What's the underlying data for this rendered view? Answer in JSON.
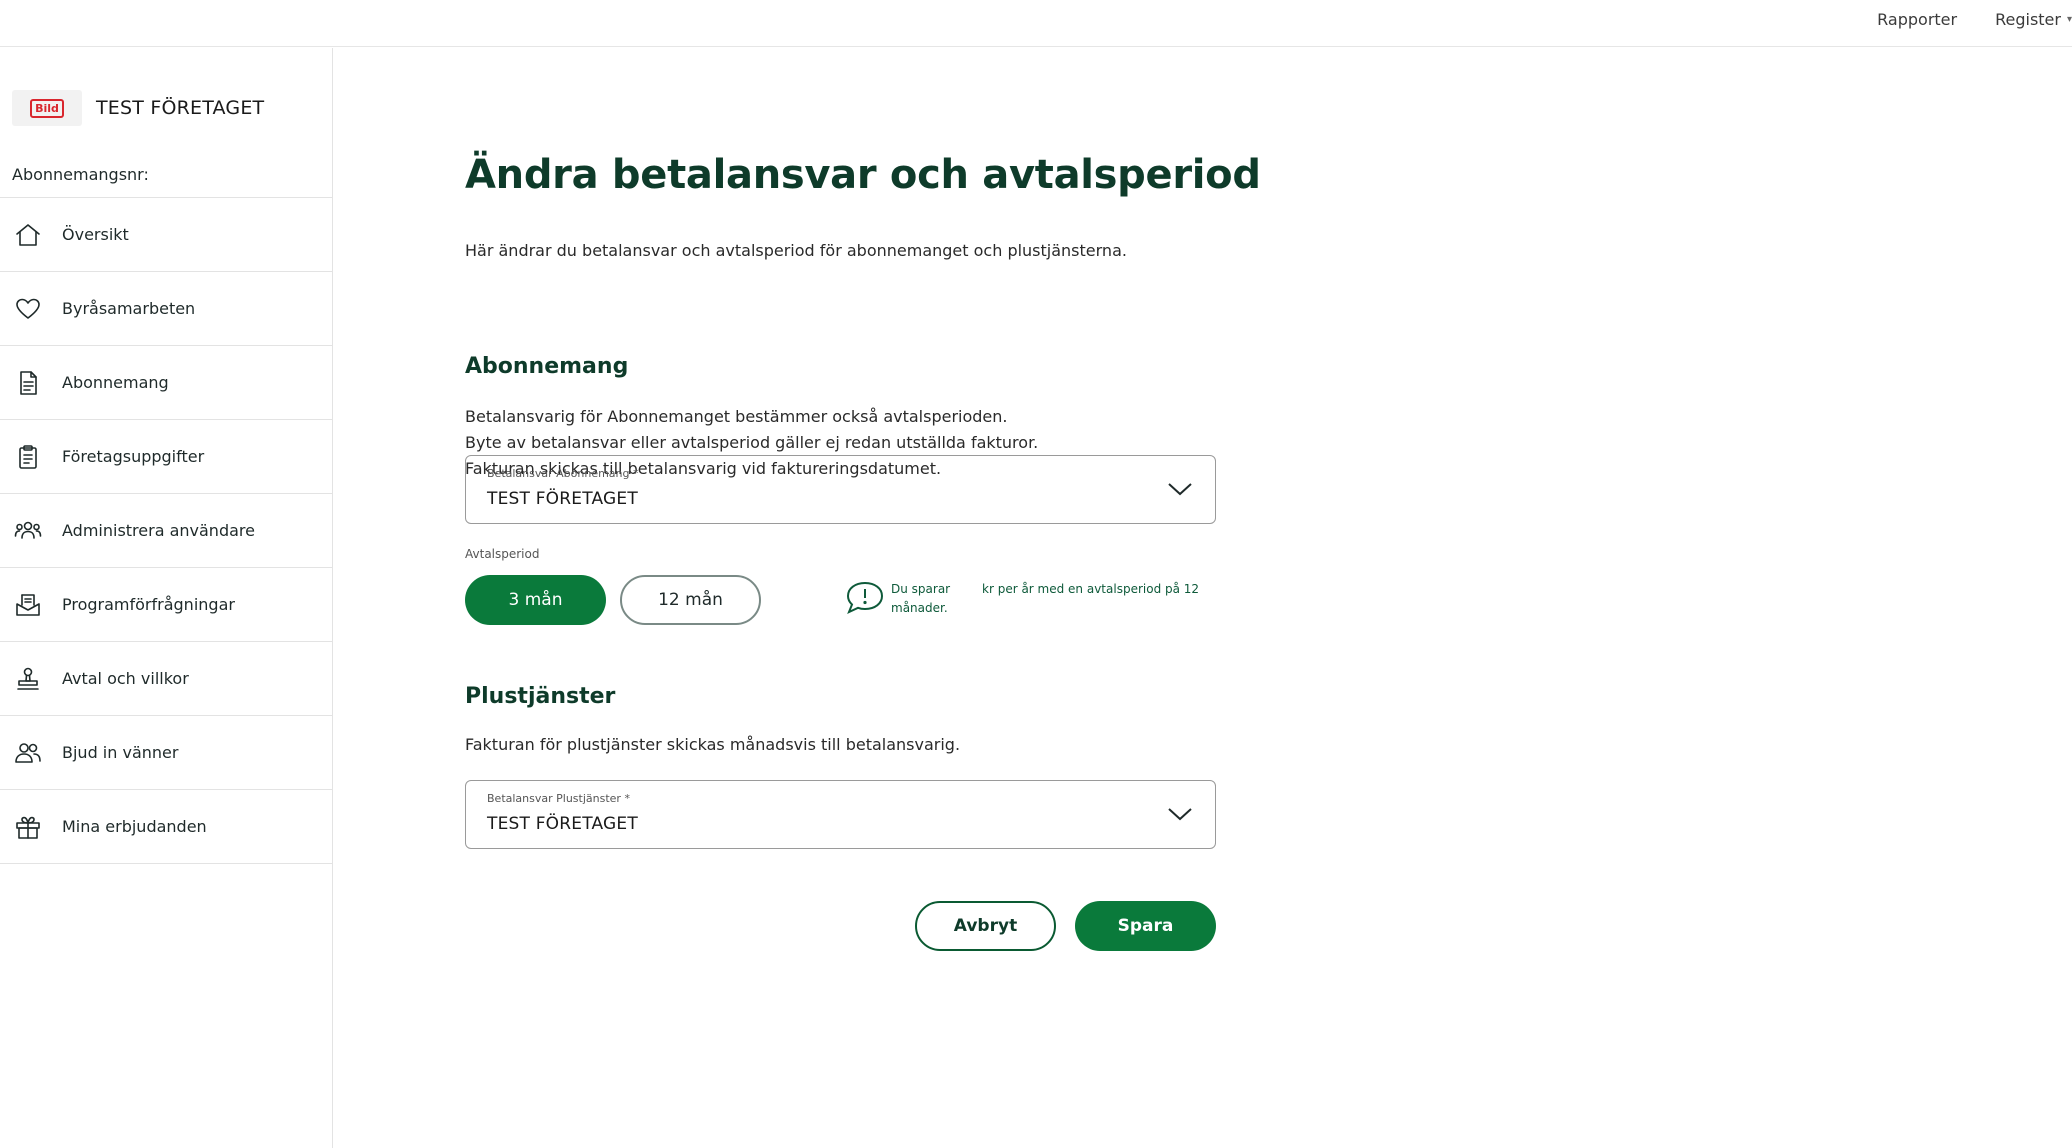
{
  "topnav": {
    "reports": "Rapporter",
    "register": "Register",
    "register_caret": "▾"
  },
  "sidebar": {
    "company_name": "TEST FÖRETAGET",
    "logo_text": "Bild",
    "subscription_label": "Abonnemangsnr:",
    "items": [
      {
        "label": "Översikt",
        "icon": "home-icon"
      },
      {
        "label": "Byråsamarbeten",
        "icon": "heart-icon"
      },
      {
        "label": "Abonnemang",
        "icon": "document-icon"
      },
      {
        "label": "Företagsuppgifter",
        "icon": "clipboard-icon"
      },
      {
        "label": "Administrera användare",
        "icon": "users-icon"
      },
      {
        "label": "Programförfrågningar",
        "icon": "inbox-icon"
      },
      {
        "label": "Avtal och villkor",
        "icon": "stamp-icon"
      },
      {
        "label": "Bjud in vänner",
        "icon": "invite-users-icon"
      },
      {
        "label": "Mina erbjudanden",
        "icon": "gift-icon"
      }
    ]
  },
  "main": {
    "title": "Ändra betalansvar och avtalsperiod",
    "intro": "Här ändrar du betalansvar och avtalsperiod för abonnemanget och plustjänsterna.",
    "subscription": {
      "heading": "Abonnemang",
      "lines": [
        "Betalansvarig för Abonnemanget bestämmer också avtalsperioden.",
        "Byte av betalansvar eller avtalsperiod gäller ej redan utställda fakturor.",
        "Fakturan skickas till betalansvarig vid faktureringsdatumet."
      ],
      "select_label": "Betalansvar Abonnemang *",
      "select_value": "TEST FÖRETAGET",
      "period_label": "Avtalsperiod",
      "period_options": [
        "3 mån",
        "12 mån"
      ],
      "period_selected": "3 mån",
      "savings_text_1": "Du sparar månader.",
      "savings_text_2": "kr per år med en avtalsperiod på 12"
    },
    "addons": {
      "heading": "Plustjänster",
      "line": "Fakturan för plustjänster skickas månadsvis till betalansvarig.",
      "select_label": "Betalansvar Plustjänster *",
      "select_value": "TEST FÖRETAGET"
    },
    "buttons": {
      "cancel": "Avbryt",
      "save": "Spara"
    }
  },
  "colors": {
    "primary": "#0a7a3b",
    "heading": "#0e3b2a",
    "logo_red": "#d9272e"
  }
}
